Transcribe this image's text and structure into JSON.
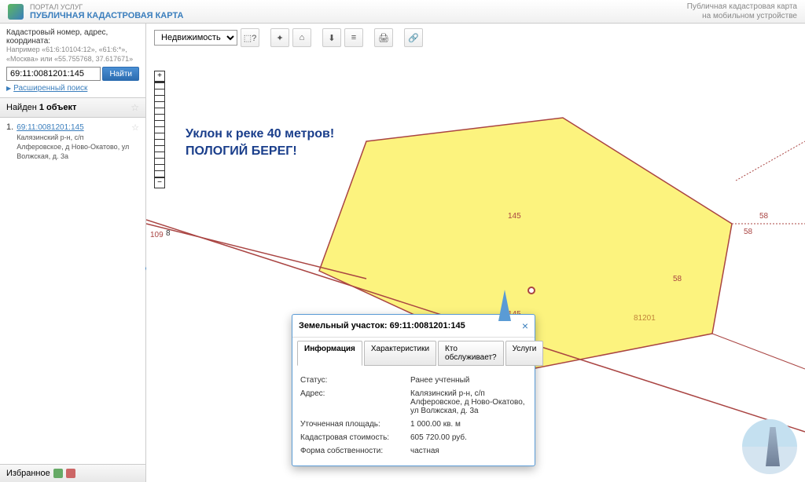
{
  "header": {
    "sub": "ПОРТАЛ УСЛУГ",
    "main": "ПУБЛИЧНАЯ КАДАСТРОВАЯ КАРТА",
    "mobile_line1": "Публичная кадастровая карта",
    "mobile_line2": "на мобильном устройстве"
  },
  "search": {
    "label": "Кадастровый номер, адрес, координата:",
    "hint": "Например «61:6:10104:12», «61:6:*», «Москва» или «55.755768, 37.617671»",
    "value": "69:11:0081201:145",
    "button": "Найти",
    "advanced": "Расширенный поиск"
  },
  "results": {
    "found_pre": "Найден ",
    "found_bold": "1 объект",
    "items": [
      {
        "num": "1.",
        "link": "69:11:0081201:145",
        "desc": "Калязинский р-н, с/п Алферовское, д Ново-Окатово, ул Волжская, д. 3а"
      }
    ]
  },
  "favorites": {
    "label": "Избранное"
  },
  "toolbar": {
    "select": "Недвижимость",
    "icons": [
      "⬚?",
      "✦",
      "⌂",
      "⬇",
      "layers",
      "🖨",
      "🔗"
    ]
  },
  "map": {
    "annotation_l1": "Уклон к реке 40 метров!",
    "annotation_l2": "ПОЛОГИЙ БЕРЕГ!",
    "labels": {
      "l109": "109",
      "l8": "8",
      "l145a": "145",
      "l145b": "145",
      "l81201": "81201",
      "l58a": "58",
      "l58b": "58",
      "l58c": "58"
    }
  },
  "popup": {
    "title": "Земельный участок: 69:11:0081201:145",
    "tabs": [
      "Информация",
      "Характеристики",
      "Кто обслуживает?",
      "Услуги"
    ],
    "rows": [
      {
        "label": "Статус:",
        "value": "Ранее учтенный"
      },
      {
        "label": "Адрес:",
        "value": "Калязинский р-н, с/п Алферовское, д Ново-Окатово, ул Волжская, д. 3а"
      },
      {
        "label": "Уточненная площадь:",
        "value": "1 000.00 кв. м"
      },
      {
        "label": "Кадастровая стоимость:",
        "value": "605 720.00 руб."
      },
      {
        "label": "Форма собственности:",
        "value": "частная"
      }
    ]
  }
}
